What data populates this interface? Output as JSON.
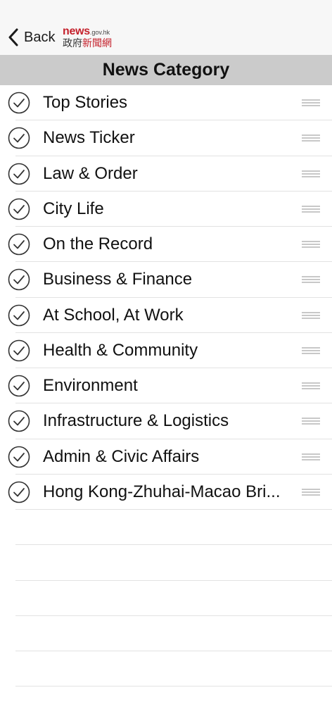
{
  "nav": {
    "back_label": "Back",
    "back_icon": "chevron-left-icon",
    "logo": {
      "news": "news",
      "domain": ".gov.hk",
      "chinese_black": "政府",
      "chinese_red": "新聞網"
    }
  },
  "header": {
    "title": "News Category"
  },
  "categories": [
    {
      "label": "Top Stories",
      "selected": true
    },
    {
      "label": "News Ticker",
      "selected": true
    },
    {
      "label": "Law & Order",
      "selected": true
    },
    {
      "label": "City Life",
      "selected": true
    },
    {
      "label": "On the Record",
      "selected": true
    },
    {
      "label": "Business & Finance",
      "selected": true
    },
    {
      "label": "At School, At Work",
      "selected": true
    },
    {
      "label": "Health & Community",
      "selected": true
    },
    {
      "label": "Environment",
      "selected": true
    },
    {
      "label": "Infrastructure & Logistics",
      "selected": true
    },
    {
      "label": "Admin & Civic Affairs",
      "selected": true
    },
    {
      "label": "Hong Kong-Zhuhai-Macao Bri...",
      "selected": true
    }
  ],
  "colors": {
    "brand_red": "#c4202b",
    "header_bg": "#cbcbcb",
    "separator": "#e2e2e2"
  }
}
